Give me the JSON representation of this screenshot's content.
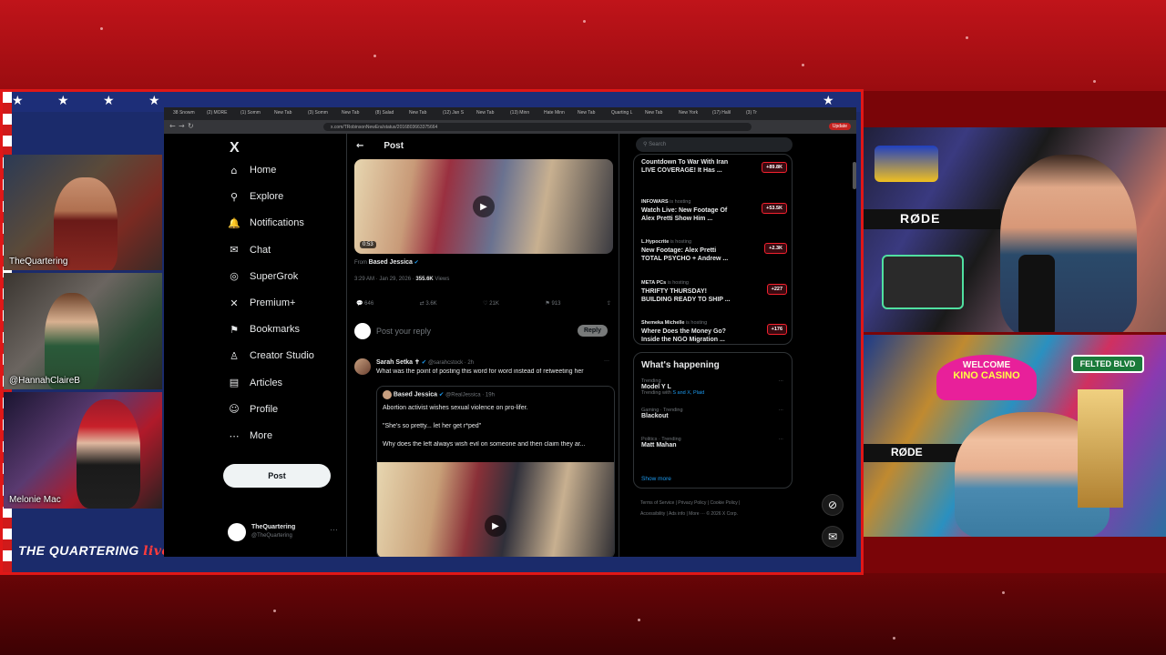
{
  "stream": {
    "cams": [
      {
        "label": "TheQuartering"
      },
      {
        "label": "@HannahClaireB"
      },
      {
        "label": "Melonie Mac"
      }
    ],
    "logo": "THE QUARTERING",
    "logo_script": "live",
    "right_cam_sign_top": "RØDE",
    "right_cam_sign_bot": "RØDE",
    "casino_welcome": "WELCOME",
    "casino_name": "KINO CASINO",
    "casino_street": "FELTED BLVD"
  },
  "browser": {
    "tabs": [
      "38 Snowm",
      "(2) MORE",
      "(1) Somm",
      "New Tab",
      "(3) Somm",
      "New Tab",
      "(8) Salad",
      "New Tab",
      "(12) Jan S",
      "New Tab",
      "(13) Minn",
      "Hate Minn",
      "New Tab",
      "Quarting L",
      "New Tab",
      "New York",
      "(17) Halil",
      "(3) Tr"
    ],
    "url": "x.com/TRobinsonNewEra/status/2016803663375664",
    "update": "Update"
  },
  "nav": {
    "logo": "X",
    "items": [
      {
        "label": "Home",
        "icon": "home-icon",
        "glyph": "⌂"
      },
      {
        "label": "Explore",
        "icon": "search-icon",
        "glyph": "⚲"
      },
      {
        "label": "Notifications",
        "icon": "bell-icon",
        "glyph": "🔔"
      },
      {
        "label": "Chat",
        "icon": "chat-icon",
        "glyph": "✉"
      },
      {
        "label": "SuperGrok",
        "icon": "grok-icon",
        "glyph": "◎"
      },
      {
        "label": "Premium+",
        "icon": "x-icon",
        "glyph": "✕"
      },
      {
        "label": "Bookmarks",
        "icon": "bookmark-icon",
        "glyph": "⚑"
      },
      {
        "label": "Creator Studio",
        "icon": "creator-icon",
        "glyph": "♙"
      },
      {
        "label": "Articles",
        "icon": "articles-icon",
        "glyph": "▤"
      },
      {
        "label": "Profile",
        "icon": "profile-icon",
        "glyph": "☺"
      },
      {
        "label": "More",
        "icon": "more-icon",
        "glyph": "⋯"
      }
    ],
    "post_button": "Post",
    "account_name": "TheQuartering",
    "account_handle": "@TheQuartering"
  },
  "post": {
    "header": "Post",
    "video_duration": "0:53",
    "from_label": "From",
    "from_name": "Based Jessica",
    "time": "3:29 AM · Jan 29, 2026 ·",
    "views": "355.6K",
    "views_label": "Views",
    "actions": {
      "replies": "646",
      "reposts": "3.6K",
      "likes": "21K",
      "bookmarks": "913"
    },
    "reply_placeholder": "Post your reply",
    "reply_button": "Reply"
  },
  "reply_tweet": {
    "name": "Sarah Setka ✝",
    "handle": "@sarahcstock · 2h",
    "text": "What was the point of posting this word for word instead of retweeting her",
    "quote": {
      "name": "Based Jessica",
      "handle": "@RealJessica · 19h",
      "line1": "Abortion activist wishes sexual violence on pro-lifer.",
      "line2": "\"She's so pretty... let her get r*ped\"",
      "line3": "Why does the left always wish evil on someone and then claim they ar..."
    }
  },
  "sidebar": {
    "search_placeholder": "Search",
    "live": [
      {
        "host": "",
        "title1": "Countdown To War With Iran",
        "title2": "LIVE COVERAGE! It Has ...",
        "count": "+89.8K"
      },
      {
        "host": "INFOWARS",
        "host_suffix": "is hosting",
        "title1": "Watch Live: New Footage Of",
        "title2": "Alex Pretti Show Him ...",
        "count": "+53.5K"
      },
      {
        "host": "L.Hypocrite",
        "host_suffix": "is hosting",
        "title1": "New Footage: Alex Pretti",
        "title2": "TOTAL PSYCHO + Andrew ...",
        "count": "+2.3K"
      },
      {
        "host": "META PCs",
        "host_suffix": "is hosting",
        "title1": "THRIFTY THURSDAY!",
        "title2": "BUILDING READY TO SHIP ...",
        "count": "+227"
      },
      {
        "host": "Shemeka Michelle",
        "host_suffix": "is hosting",
        "title1": "Where Does the Money Go?",
        "title2": "Inside the NGO Migration ...",
        "count": "+176"
      }
    ],
    "whats_happening": "What's happening",
    "trends": [
      {
        "context": "Trending",
        "name": "Model Y L",
        "sub": "Trending with",
        "sub_link": "S and X, Plaid"
      },
      {
        "context": "Gaming · Trending",
        "name": "Blackout",
        "sub": "",
        "sub_link": ""
      },
      {
        "context": "Politics · Trending",
        "name": "Matt Mahan",
        "sub": "",
        "sub_link": ""
      }
    ],
    "show_more": "Show more",
    "footer1": "Terms of Service  |  Privacy Policy  |  Cookie Policy  |",
    "footer2": "Accessibility  |  Ads info  |  More ···  © 2026 X Corp."
  }
}
